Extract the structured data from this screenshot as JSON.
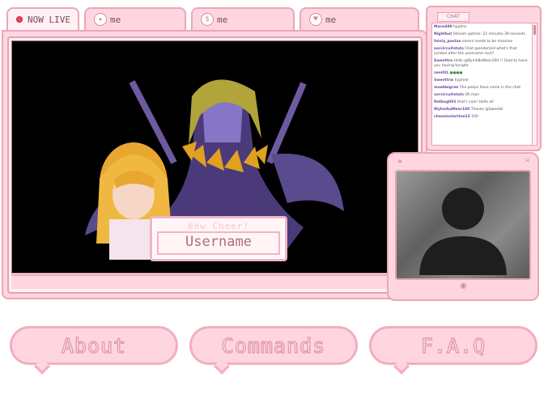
{
  "tabs": [
    {
      "label": "NOW LIVE",
      "icon": "live-dot"
    },
    {
      "label": "me",
      "icon": "star-icon"
    },
    {
      "label": "me",
      "icon": "dollar-icon"
    },
    {
      "label": "me",
      "icon": "heart-icon"
    }
  ],
  "cheer": {
    "title": "New Cheer!",
    "username": "Username"
  },
  "chat": {
    "tab_label": "CHAT",
    "messages": [
      {
        "user": "Mace499",
        "text": "hyphns"
      },
      {
        "user": "Nightbot",
        "text": "Stream uptime: 22 minutes 39 seconds."
      },
      {
        "user": "feisty_pastas",
        "text": "enrenl needs to be massive"
      },
      {
        "user": "xorcircuitstats",
        "text": "Chat @enderzed what's that symbol after the username rock?"
      },
      {
        "user": "Sweettra",
        "text": "Hello @BynihBaMear100 !! Glad to have you having tonight"
      },
      {
        "user": "zenil01",
        "text": ""
      },
      {
        "user": "Sweettrw",
        "text": "hyphne"
      },
      {
        "user": "maebbigree",
        "text": "The peeps have come in the chat"
      },
      {
        "user": "xorcircuitstats",
        "text": "Oh man"
      },
      {
        "user": "fietbug001",
        "text": "that's cool! Hello all"
      },
      {
        "user": "WyhnibaMear180",
        "text": "Thanks @Sweetkl"
      },
      {
        "user": "chessinstarline22",
        "text": "100"
      }
    ]
  },
  "nav": {
    "about": "About",
    "commands": "Commands",
    "faq": "F.A.Q"
  },
  "colors": {
    "frame": "#ffd6e0",
    "border": "#e9a8b9",
    "live": "#ff3b5c"
  }
}
